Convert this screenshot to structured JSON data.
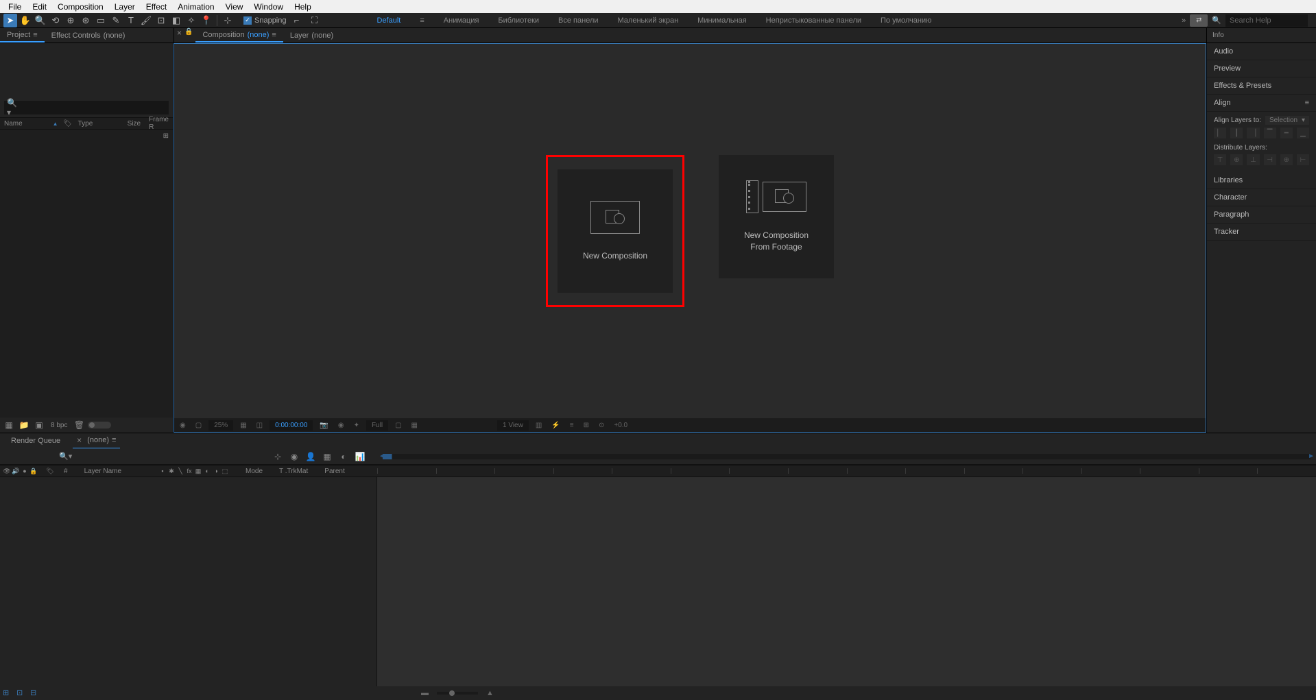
{
  "menubar": [
    "File",
    "Edit",
    "Composition",
    "Layer",
    "Effect",
    "Animation",
    "View",
    "Window",
    "Help"
  ],
  "toolbar": {
    "snapping": "Snapping",
    "workspaces": [
      "Default",
      "Анимация",
      "Библиотеки",
      "Все панели",
      "Маленький экран",
      "Минимальная",
      "Непристыкованные панели",
      "По умолчанию"
    ],
    "search_placeholder": "Search Help"
  },
  "panels": {
    "project_tab": "Project",
    "effect_controls_tab": "Effect Controls",
    "effect_controls_none": "(none)",
    "comp_tab_prefix": "Composition",
    "comp_tab_none": "(none)",
    "layer_tab": "Layer",
    "layer_tab_none": "(none)"
  },
  "project_cols": {
    "name": "Name",
    "type": "Type",
    "size": "Size",
    "frame": "Frame R"
  },
  "project_footer": {
    "bpc": "8 bpc"
  },
  "comp_cards": {
    "new_comp": "New Composition",
    "from_footage_l1": "New Composition",
    "from_footage_l2": "From Footage"
  },
  "comp_footer": {
    "zoom": "25%",
    "time": "0:00:00:00",
    "res": "Full",
    "views": "1 View",
    "exposure": "+0.0"
  },
  "right_panels": [
    "Info",
    "Audio",
    "Preview",
    "Effects & Presets"
  ],
  "align_panel": {
    "title": "Align",
    "layers_to": "Align Layers to:",
    "selection": "Selection",
    "distribute": "Distribute Layers:"
  },
  "right_panels2": [
    "Libraries",
    "Character",
    "Paragraph",
    "Tracker"
  ],
  "timeline": {
    "render_queue": "Render Queue",
    "none": "(none)",
    "layer_cols": {
      "num": "#",
      "layer_name": "Layer Name",
      "mode": "Mode",
      "trkmat": "T .TrkMat",
      "parent": "Parent"
    }
  }
}
